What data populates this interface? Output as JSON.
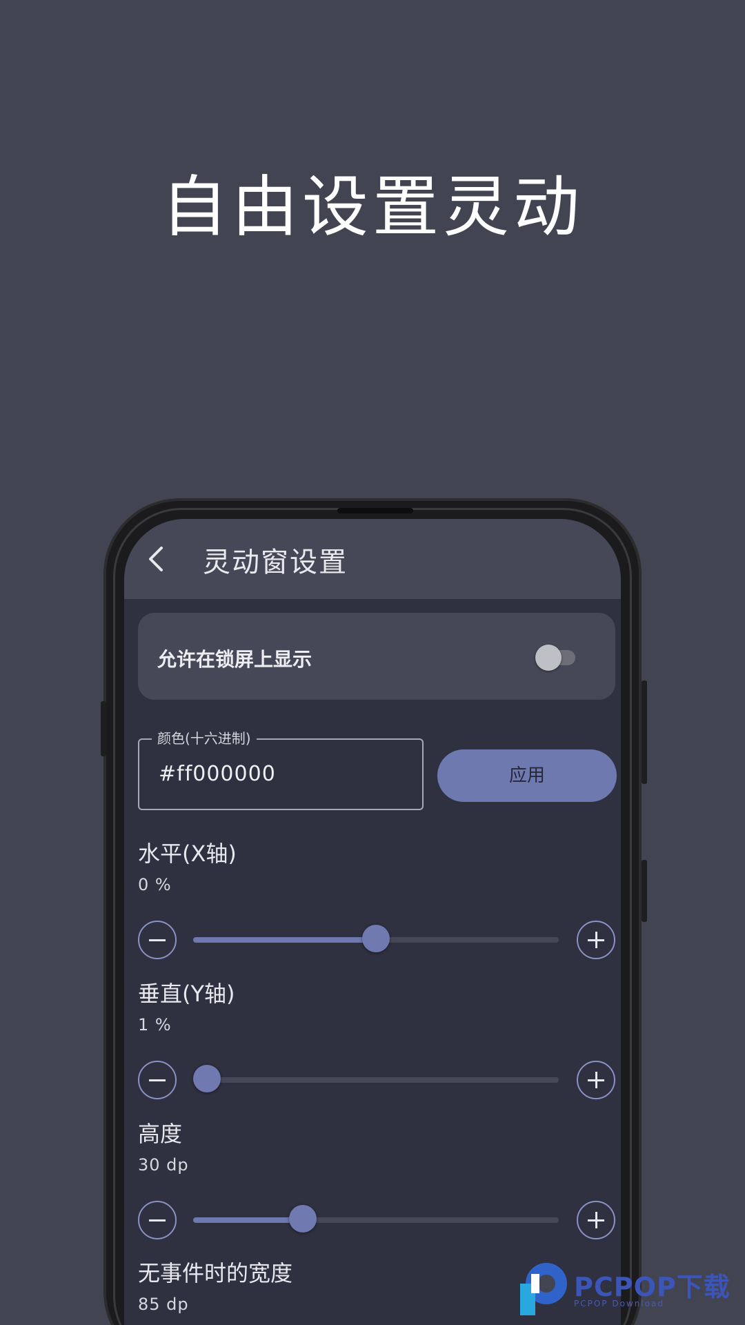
{
  "headline": "自由设置灵动",
  "appbar": {
    "title": "灵动窗设置"
  },
  "lockscreen": {
    "label": "允许在锁屏上显示",
    "enabled": false
  },
  "color_field": {
    "label": "颜色(十六进制)",
    "value": "#ff000000"
  },
  "apply_button": {
    "label": "应用"
  },
  "settings": [
    {
      "title": "水平(X轴)",
      "value": "0 %",
      "slider_fraction": 0.5
    },
    {
      "title": "垂直(Y轴)",
      "value": "1 %",
      "slider_fraction": 0.01
    },
    {
      "title": "高度",
      "value": "30 dp",
      "slider_fraction": 0.3
    },
    {
      "title": "无事件时的宽度",
      "value": "85 dp"
    }
  ],
  "watermark": {
    "brand": "PCPOP下载",
    "sub": "PCPOP Download"
  },
  "colors": {
    "background": "#434452",
    "screen": "#2f3040",
    "card": "#464858",
    "accent": "#6e79b0"
  }
}
